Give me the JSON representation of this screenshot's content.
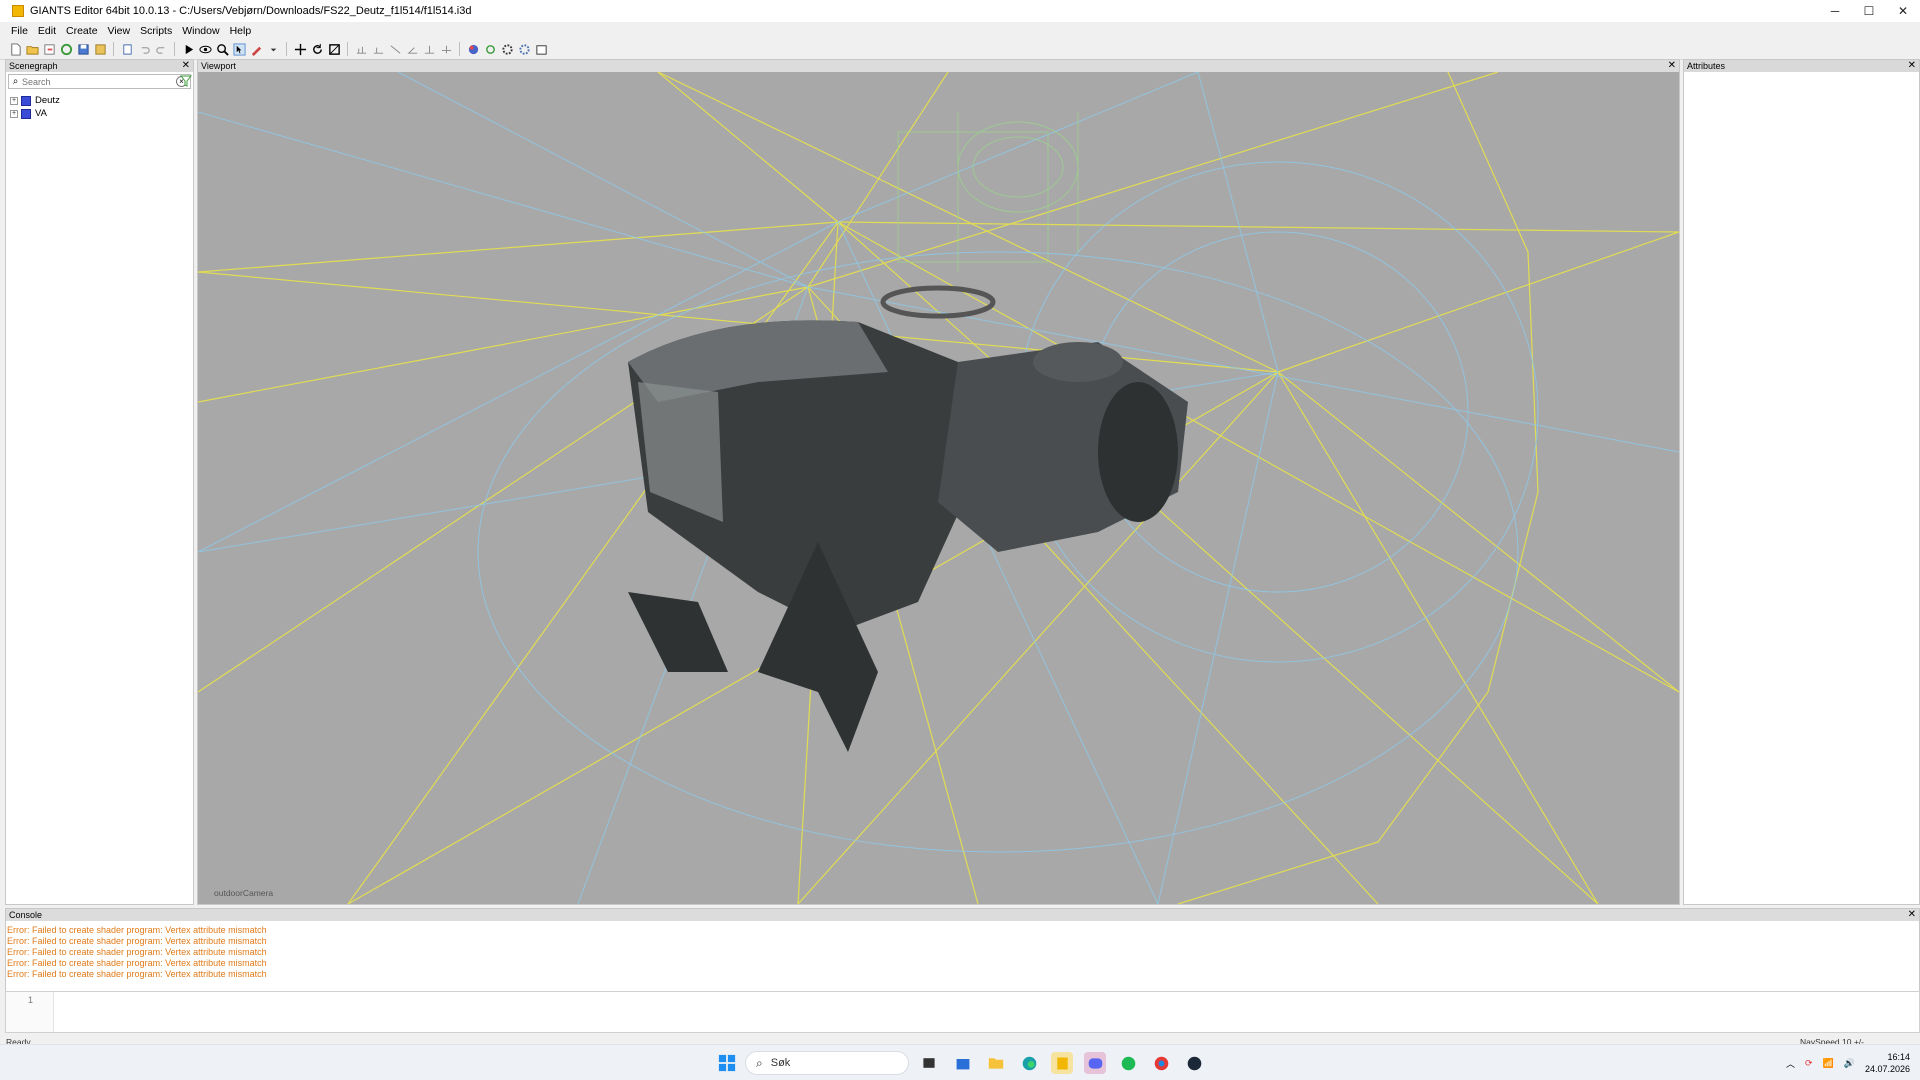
{
  "window": {
    "title": "GIANTS Editor 64bit 10.0.13 - C:/Users/Vebjørn/Downloads/FS22_Deutz_f1l514/f1l514.i3d",
    "minimize": "─",
    "maximize": "☐",
    "close": "✕"
  },
  "menu": [
    "File",
    "Edit",
    "Create",
    "View",
    "Scripts",
    "Window",
    "Help"
  ],
  "panels": {
    "scenegraph": {
      "title": "Scenegraph",
      "close": "✕",
      "search_placeholder": "Search",
      "nodes": [
        {
          "label": "Deutz",
          "color": "#3a4cd6"
        },
        {
          "label": "VA",
          "color": "#3a4cd6"
        }
      ]
    },
    "viewport": {
      "title": "Viewport",
      "close": "✕",
      "camera": "outdoorCamera"
    },
    "attributes": {
      "title": "Attributes",
      "close": "✕"
    },
    "console": {
      "title": "Console",
      "close": "✕",
      "lines": [
        "Error: Failed to create shader program: Vertex attribute mismatch",
        "Error: Failed to create shader program: Vertex attribute mismatch",
        "Error: Failed to create shader program: Vertex attribute mismatch",
        "Error: Failed to create shader program: Vertex attribute mismatch",
        "Error: Failed to create shader program: Vertex attribute mismatch"
      ],
      "error_color": "#e07b1a"
    },
    "command": {
      "line_number": "1"
    }
  },
  "status": {
    "left": "Ready",
    "right": "NavSpeed 10 +/-"
  },
  "taskbar": {
    "search_label": "Søk",
    "time": "16:14",
    "date": "24.07.2026"
  },
  "colors": {
    "viewport_bg": "#a8a8a8",
    "wire_yellow": "#e8e24a",
    "wire_blue": "#8fc8e8",
    "wire_green": "#9bd88a"
  }
}
